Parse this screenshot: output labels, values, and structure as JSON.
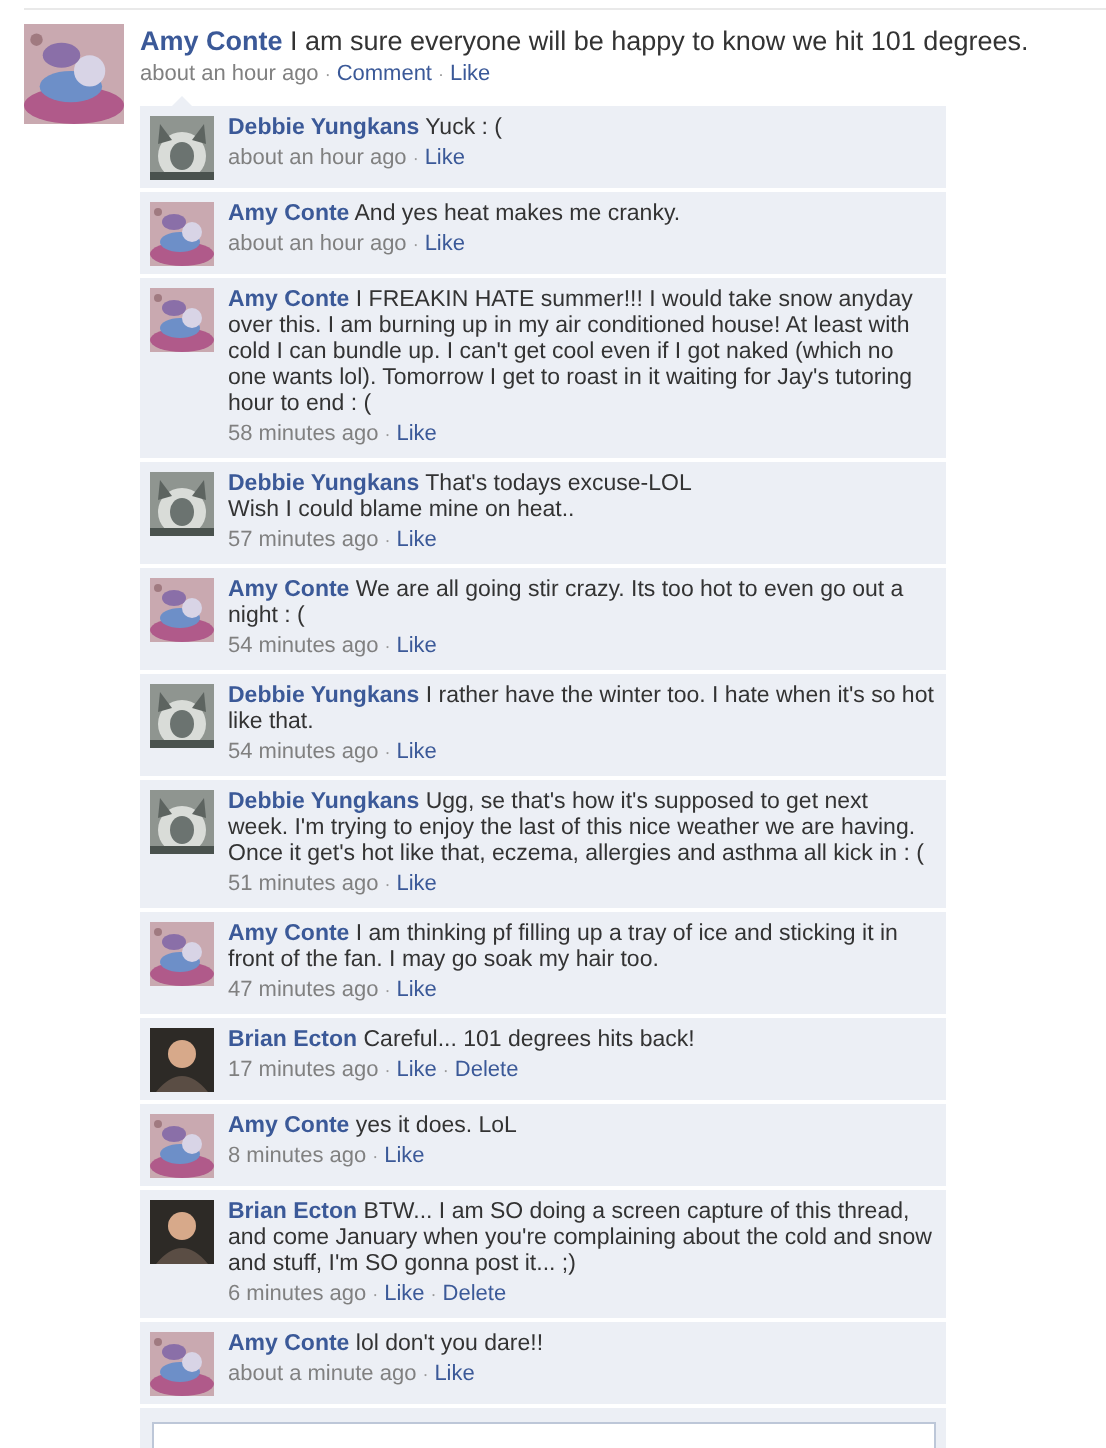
{
  "post": {
    "author": "Amy Conte",
    "text": "I am sure everyone will be happy to know we hit 101 degrees.",
    "avatar": {
      "kind": "picture"
    },
    "time": "about an hour ago",
    "actions": [
      {
        "label": "Comment",
        "separator": "·"
      },
      {
        "label": "Like",
        "separator": "·"
      }
    ]
  },
  "comments": [
    {
      "author": "Debbie Yungkans",
      "text": "Yuck : (",
      "avatar": {
        "kind": "picture"
      },
      "time": "about an hour ago",
      "actions": [
        {
          "label": "Like",
          "separator": "·"
        }
      ]
    },
    {
      "author": "Amy Conte",
      "text": "And yes heat makes me cranky.",
      "avatar": {
        "kind": "picture"
      },
      "time": "about an hour ago",
      "actions": [
        {
          "label": "Like",
          "separator": "·"
        }
      ]
    },
    {
      "author": "Amy Conte",
      "text": "I FREAKIN HATE summer!!! I would take snow anyday over this. I am burning up in my air conditioned house! At least with cold I can bundle up. I can't get cool even if I got naked (which no one wants lol). Tomorrow I get to roast in it waiting for Jay's tutoring hour to end : (",
      "avatar": {
        "kind": "picture"
      },
      "time": "58 minutes ago",
      "actions": [
        {
          "label": "Like",
          "separator": "·"
        }
      ]
    },
    {
      "author": "Debbie Yungkans",
      "text": "That's todays excuse-LOL\nWish I could blame mine on heat..",
      "avatar": {
        "kind": "picture"
      },
      "time": "57 minutes ago",
      "actions": [
        {
          "label": "Like",
          "separator": "·"
        }
      ]
    },
    {
      "author": "Amy Conte",
      "text": "We are all going stir crazy. Its too hot to even go out a night : (",
      "avatar": {
        "kind": "picture"
      },
      "time": "54 minutes ago",
      "actions": [
        {
          "label": "Like",
          "separator": "·"
        }
      ]
    },
    {
      "author": "Debbie Yungkans",
      "text": "I rather have the winter too. I hate when it's so hot like that.",
      "avatar": {
        "kind": "picture"
      },
      "time": "54 minutes ago",
      "actions": [
        {
          "label": "Like",
          "separator": "·"
        }
      ]
    },
    {
      "author": "Debbie Yungkans",
      "text": "Ugg, se that's how it's supposed to get next week. I'm trying to enjoy the last of this nice weather we are having. Once it get's hot like that, eczema, allergies and asthma all kick in : (",
      "avatar": {
        "kind": "picture"
      },
      "time": "51 minutes ago",
      "actions": [
        {
          "label": "Like",
          "separator": "·"
        }
      ]
    },
    {
      "author": "Amy Conte",
      "text": "I am thinking pf filling up a tray of ice and sticking it in front of the fan. I may go soak my hair too.",
      "avatar": {
        "kind": "picture"
      },
      "time": "47 minutes ago",
      "actions": [
        {
          "label": "Like",
          "separator": "·"
        }
      ]
    },
    {
      "author": "Brian Ecton",
      "text": "Careful... 101 degrees hits back!",
      "avatar": {
        "kind": "silhouette"
      },
      "time": "17 minutes ago",
      "actions": [
        {
          "label": "Like",
          "separator": "·"
        },
        {
          "label": "Delete",
          "separator": "·"
        }
      ]
    },
    {
      "author": "Amy Conte",
      "text": "yes it does. LoL",
      "avatar": {
        "kind": "picture"
      },
      "time": "8 minutes ago",
      "actions": [
        {
          "label": "Like",
          "separator": "·"
        }
      ]
    },
    {
      "author": "Brian Ecton",
      "text": "BTW... I am SO doing a screen capture of this thread, and come January when you're complaining about the cold and snow and stuff, I'm SO gonna post it... ;)",
      "avatar": {
        "kind": "silhouette"
      },
      "time": "6 minutes ago",
      "actions": [
        {
          "label": "Like",
          "separator": "·"
        },
        {
          "label": "Delete",
          "separator": "·"
        }
      ]
    },
    {
      "author": "Amy Conte",
      "text": "lol don't you dare!!",
      "avatar": {
        "kind": "picture"
      },
      "time": "about a minute ago",
      "actions": [
        {
          "label": "Like",
          "separator": "·"
        }
      ]
    }
  ],
  "comment_box": {
    "kind": "field"
  }
}
